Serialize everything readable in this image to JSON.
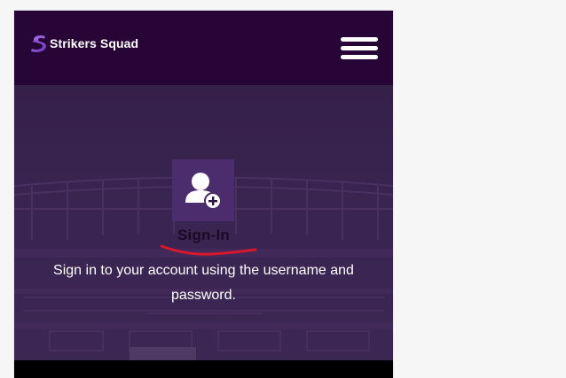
{
  "header": {
    "brand_name": "Strikers Squad",
    "logo_icon": "strikers-s-logo",
    "menu_icon": "hamburger-menu-icon"
  },
  "hero": {
    "icon": "user-add-icon",
    "title": "Sign-In",
    "description": "Sign in to your account using the username and password."
  },
  "colors": {
    "header_bg": "#270536",
    "hero_bg": "#3a2451",
    "icon_box_bg": "#4b2d6d",
    "annotation_red": "#d8172a"
  }
}
